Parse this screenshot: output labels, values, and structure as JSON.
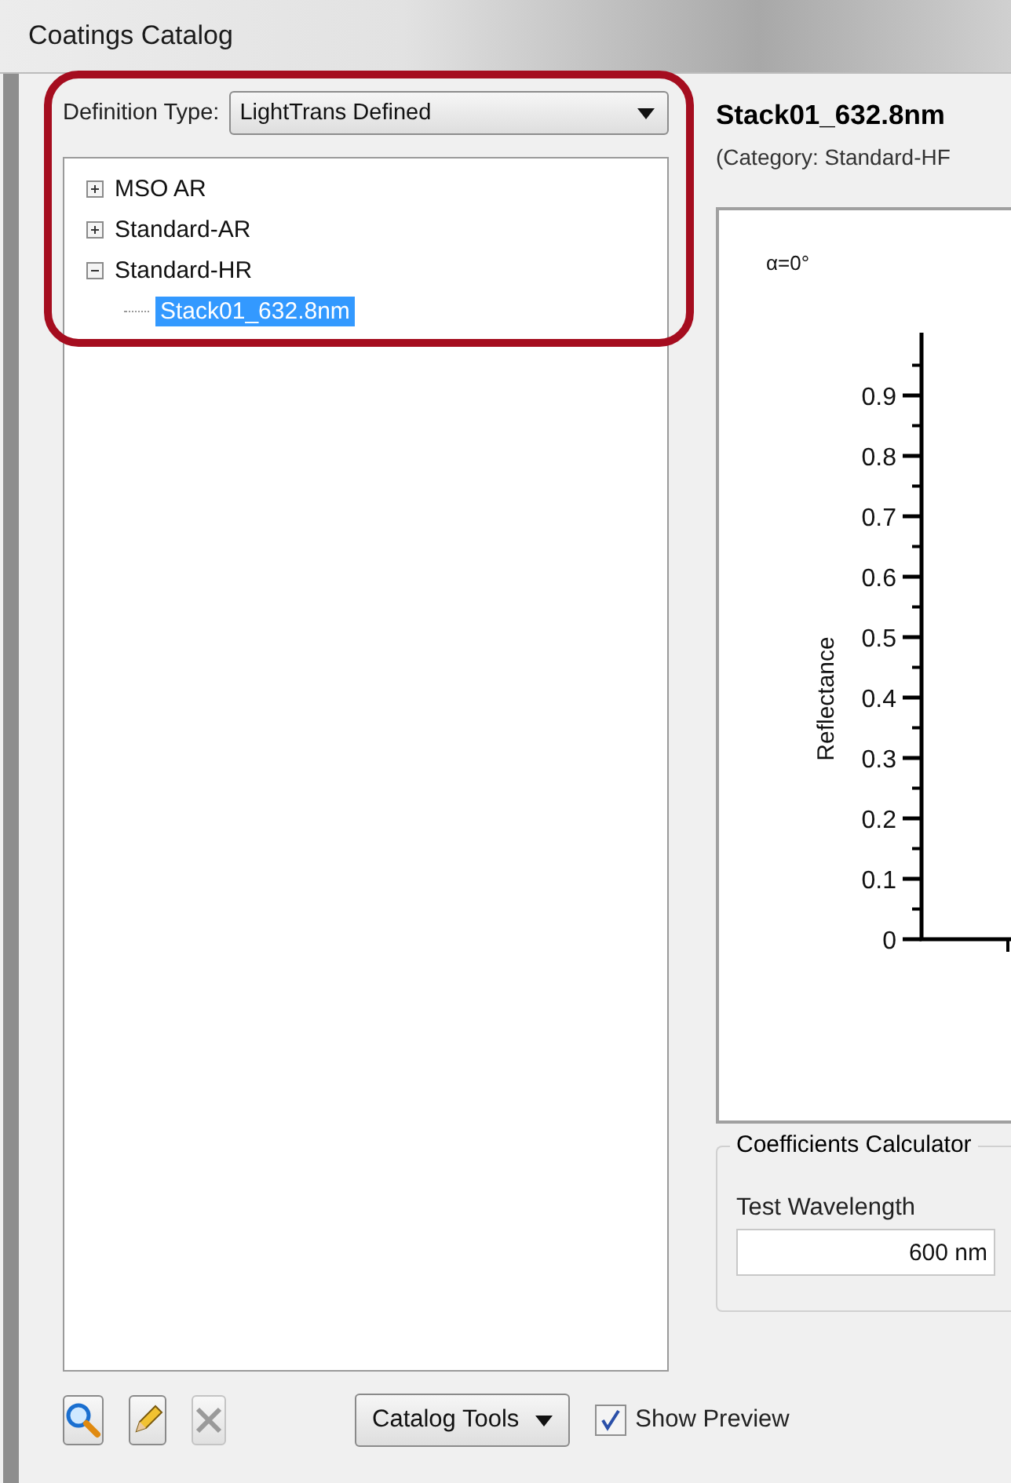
{
  "window": {
    "title": "Coatings Catalog"
  },
  "definition_type": {
    "label": "Definition Type:",
    "value": "LightTrans Defined"
  },
  "tree": [
    {
      "label": "MSO AR",
      "expanded": false,
      "selected": false
    },
    {
      "label": "Standard-AR",
      "expanded": false,
      "selected": false
    },
    {
      "label": "Standard-HR",
      "expanded": true,
      "selected": false,
      "children": [
        {
          "label": "Stack01_632.8nm",
          "selected": true
        }
      ]
    }
  ],
  "toolbar": [
    {
      "kind": "search",
      "disabled": false
    },
    {
      "kind": "edit",
      "disabled": false
    },
    {
      "kind": "delete",
      "disabled": true
    }
  ],
  "catalog_tools": {
    "label": "Catalog Tools"
  },
  "show_preview": {
    "label": "Show Preview",
    "checked": true
  },
  "detail": {
    "title": "Stack01_632.8nm",
    "category": "(Category: Standard-HF",
    "plot": {
      "title": "α=0°",
      "ylabel": "Reflectance",
      "yticks": [
        "0.9",
        "0.8",
        "0.7",
        "0.6",
        "0.5",
        "0.4",
        "0.3",
        "0.2",
        "0.1",
        "0"
      ]
    }
  },
  "calculator": {
    "title": "Coefficients Calculator",
    "label": "Test Wavelength",
    "value": "600 nm"
  }
}
